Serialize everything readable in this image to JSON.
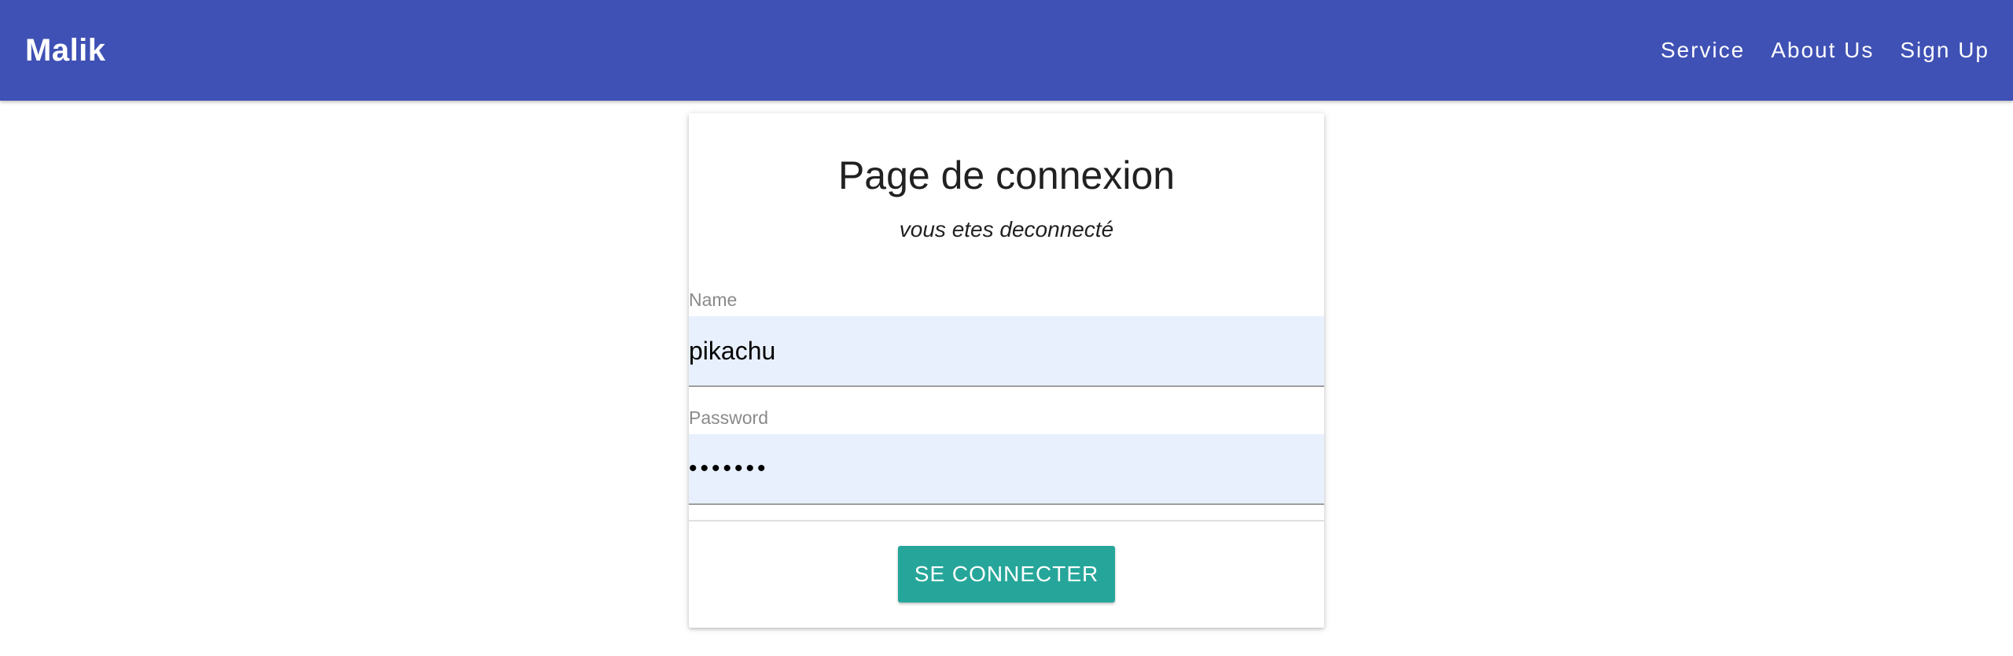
{
  "navbar": {
    "brand": "Malik",
    "links": [
      "Service",
      "About Us",
      "Sign Up"
    ],
    "background_color": "#3f51b5"
  },
  "login_card": {
    "title": "Page de connexion",
    "subtitle": "vous etes deconnecté",
    "name_field": {
      "label": "Name",
      "value": "pikachu"
    },
    "password_field": {
      "label": "Password",
      "value": "•••••••"
    },
    "submit_label": "SE CONNECTER",
    "button_color": "#26a69a",
    "input_fill_color": "#e8f0fe"
  }
}
